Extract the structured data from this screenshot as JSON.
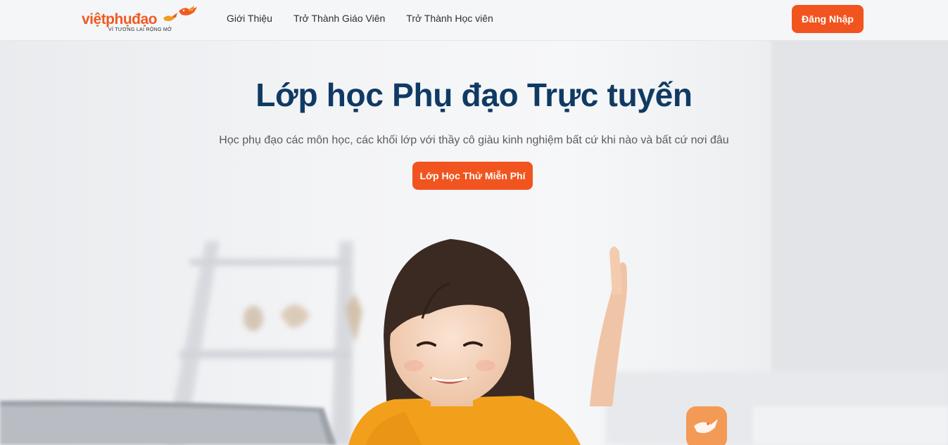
{
  "brand": {
    "name": "việtphụđạo",
    "tagline": "VÌ TƯƠNG LAI RỘNG MỞ",
    "color": "#ef5a24"
  },
  "nav": {
    "items": [
      {
        "label": "Giới Thiệu"
      },
      {
        "label": "Trở Thành Giáo Viên"
      },
      {
        "label": "Trở Thành Học viên"
      }
    ],
    "login_label": "Đăng Nhập"
  },
  "hero": {
    "title": "Lớp học Phụ đạo Trực tuyến",
    "subtitle": "Học phụ đạo các môn học, các khối lớp với thầy cô giàu kinh nghiệm bất cứ khi nào và bất cứ nơi đâu",
    "cta_label": "Lớp Học Thử Miễn Phí",
    "title_color": "#0f3a63",
    "accent_color": "#f1541f"
  }
}
